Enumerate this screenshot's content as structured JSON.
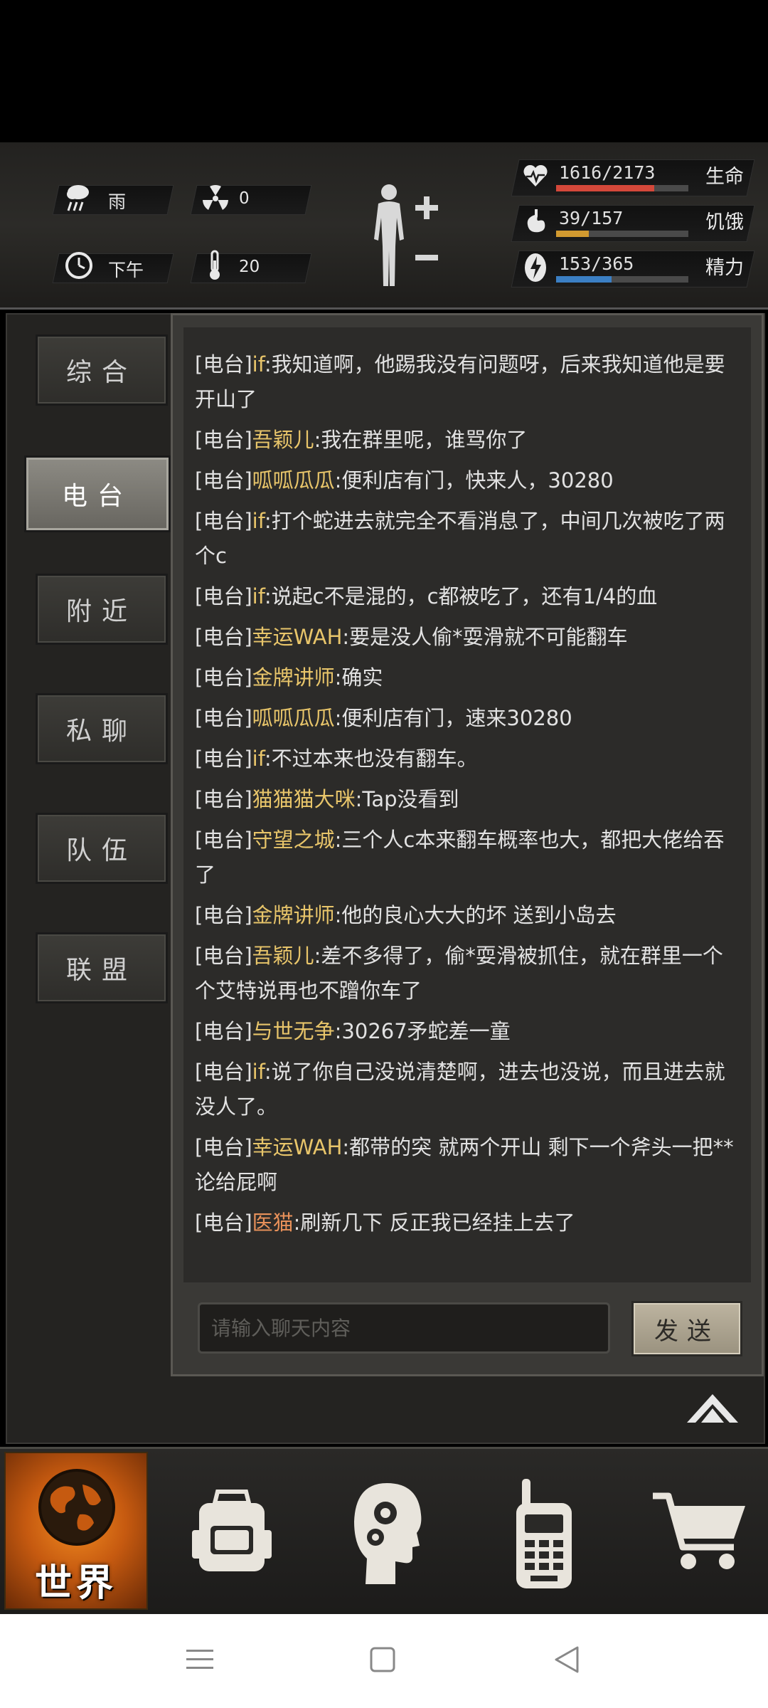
{
  "status": {
    "weather": "雨",
    "radiation": "0",
    "time_of_day": "下午",
    "temperature": "20",
    "stats": [
      {
        "icon": "heart-pulse-icon",
        "value": "1616/2173",
        "label": "生命",
        "fraction": 0.744,
        "color": "#d4483a"
      },
      {
        "icon": "stomach-icon",
        "value": "39/157",
        "label": "饥饿",
        "fraction": 0.248,
        "color": "#d29a30"
      },
      {
        "icon": "energy-icon",
        "value": "153/365",
        "label": "精力",
        "fraction": 0.419,
        "color": "#3b7fc4"
      }
    ]
  },
  "tabs": [
    {
      "label": "综合",
      "active": false
    },
    {
      "label": "电台",
      "active": true
    },
    {
      "label": "附近",
      "active": false
    },
    {
      "label": "私聊",
      "active": false
    },
    {
      "label": "队伍",
      "active": false
    },
    {
      "label": "联盟",
      "active": false
    }
  ],
  "chat": {
    "messages": [
      {
        "channel": "[电台]",
        "sender": "if",
        "sender_color": "gold",
        "text": ":我知道啊，他踢我没有问题呀，后来我知道他是要开山了"
      },
      {
        "channel": "[电台]",
        "sender": "吾颖儿",
        "sender_color": "gold",
        "text": ":我在群里呢，谁骂你了"
      },
      {
        "channel": "[电台]",
        "sender": "呱呱瓜瓜",
        "sender_color": "gold",
        "text": ":便利店有门，快来人，30280"
      },
      {
        "channel": "[电台]",
        "sender": "if",
        "sender_color": "gold",
        "text": ":打个蛇进去就完全不看消息了，中间几次被吃了两个c"
      },
      {
        "channel": "[电台]",
        "sender": "if",
        "sender_color": "gold",
        "text": ":说起c不是混的，c都被吃了，还有1/4的血"
      },
      {
        "channel": "[电台]",
        "sender": "幸运WAH",
        "sender_color": "gold",
        "text": ":要是没人偷*耍滑就不可能翻车"
      },
      {
        "channel": "[电台]",
        "sender": "金牌讲师",
        "sender_color": "gold",
        "text": ":确实"
      },
      {
        "channel": "[电台]",
        "sender": "呱呱瓜瓜",
        "sender_color": "gold",
        "text": ":便利店有门，速来30280"
      },
      {
        "channel": "[电台]",
        "sender": "if",
        "sender_color": "gold",
        "text": ":不过本来也没有翻车。"
      },
      {
        "channel": "[电台]",
        "sender": "猫猫猫大咪",
        "sender_color": "gold",
        "text": ":Tap没看到"
      },
      {
        "channel": "[电台]",
        "sender": "守望之城",
        "sender_color": "gold",
        "text": ":三个人c本来翻车概率也大，都把大佬给吞了"
      },
      {
        "channel": "[电台]",
        "sender": "金牌讲师",
        "sender_color": "gold",
        "text": ":他的良心大大的坏 送到小岛去"
      },
      {
        "channel": "[电台]",
        "sender": "吾颖儿",
        "sender_color": "gold",
        "text": ":差不多得了，偷*耍滑被抓住，就在群里一个个艾特说再也不蹭你车了"
      },
      {
        "channel": "[电台]",
        "sender": "与世无争",
        "sender_color": "gold",
        "text": ":30267矛蛇差一童"
      },
      {
        "channel": "[电台]",
        "sender": "if",
        "sender_color": "gold",
        "text": ":说了你自己没说清楚啊，进去也没说，而且进去就没人了。"
      },
      {
        "channel": "[电台]",
        "sender": "幸运WAH",
        "sender_color": "gold",
        "text": ":都带的突 就两个开山 剩下一个斧头一把**论给屁啊"
      },
      {
        "channel": "[电台]",
        "sender": "医猫",
        "sender_color": "orange",
        "text": ":刷新几下 反正我已经挂上去了"
      }
    ],
    "input_placeholder": "请输入聊天内容",
    "send_label": "发送"
  },
  "bottom_nav": {
    "world_label": "世界",
    "items": [
      "globe-icon",
      "backpack-icon",
      "head-gears-icon",
      "walkie-talkie-icon",
      "shopping-cart-icon"
    ]
  },
  "colors": {
    "gold_name": "#e8c56a",
    "orange_name": "#e8915a",
    "health": "#d4483a",
    "hunger": "#d29a30",
    "energy": "#3b7fc4"
  }
}
